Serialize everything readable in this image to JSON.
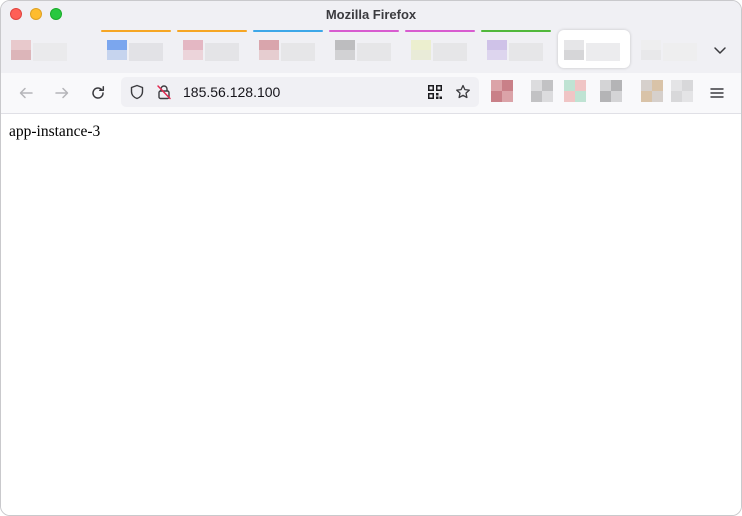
{
  "window": {
    "title": "Mozilla Firefox",
    "traffic_lights": {
      "close_color": "#ff5f57",
      "minimize_color": "#febc2e",
      "maximize_color": "#28c840"
    }
  },
  "tabs": [
    {
      "accent": null,
      "blocks": [
        "#e8c9cc",
        "#dcb5b9",
        "#eaeaec"
      ]
    },
    {
      "accent": "#f6a624",
      "blocks": [
        "#7ba6ee",
        "#c6d4ee",
        "#e2e2e6"
      ]
    },
    {
      "accent": "#f6a624",
      "blocks": [
        "#e4b7c3",
        "#ecd4da",
        "#e4e4e7"
      ]
    },
    {
      "accent": "#3da7e8",
      "blocks": [
        "#d9a5ac",
        "#e6cdd0",
        "#e6e6e8"
      ]
    },
    {
      "accent": "#d85bd0",
      "blocks": [
        "#bdbdbf",
        "#d2d2d4",
        "#e6e6e8"
      ]
    },
    {
      "accent": "#d85bd0",
      "blocks": [
        "#ecefcf",
        "#e9ebd8",
        "#e6e6e8"
      ]
    },
    {
      "accent": "#51b83b",
      "blocks": [
        "#cfc2e8",
        "#ddd5ee",
        "#e6e6e8"
      ]
    },
    {
      "accent": null,
      "active": true,
      "blocks": [
        "#e6e6e8",
        "#d6d6d8",
        "#ececee"
      ]
    },
    {
      "accent": null,
      "blocks": [
        "#eeeeef",
        "#e8e8ea",
        "#eeeeef"
      ]
    }
  ],
  "navbar": {
    "back_icon": "arrow-left-icon",
    "forward_icon": "arrow-right-icon",
    "reload_icon": "reload-icon",
    "url": "185.56.128.100",
    "site_icons": [
      "shield-icon",
      "insecure-lock-icon"
    ],
    "url_actions": [
      "qr-code-icon",
      "bookmark-star-icon"
    ],
    "extensions": [
      [
        "#dba3a8",
        "#c98088"
      ],
      [
        "#dcdcde",
        "#c2c2c4"
      ],
      [
        "#bfe3d3",
        "#f0c5c5"
      ],
      [
        "#d4d4d6",
        "#b4b4b6"
      ],
      [
        "#d6d0cc",
        "#d9c3a8"
      ],
      [
        "#e4e4e6",
        "#d8d8da"
      ]
    ],
    "menu_icon": "hamburger-menu-icon"
  },
  "content": {
    "text": "app-instance-3"
  }
}
